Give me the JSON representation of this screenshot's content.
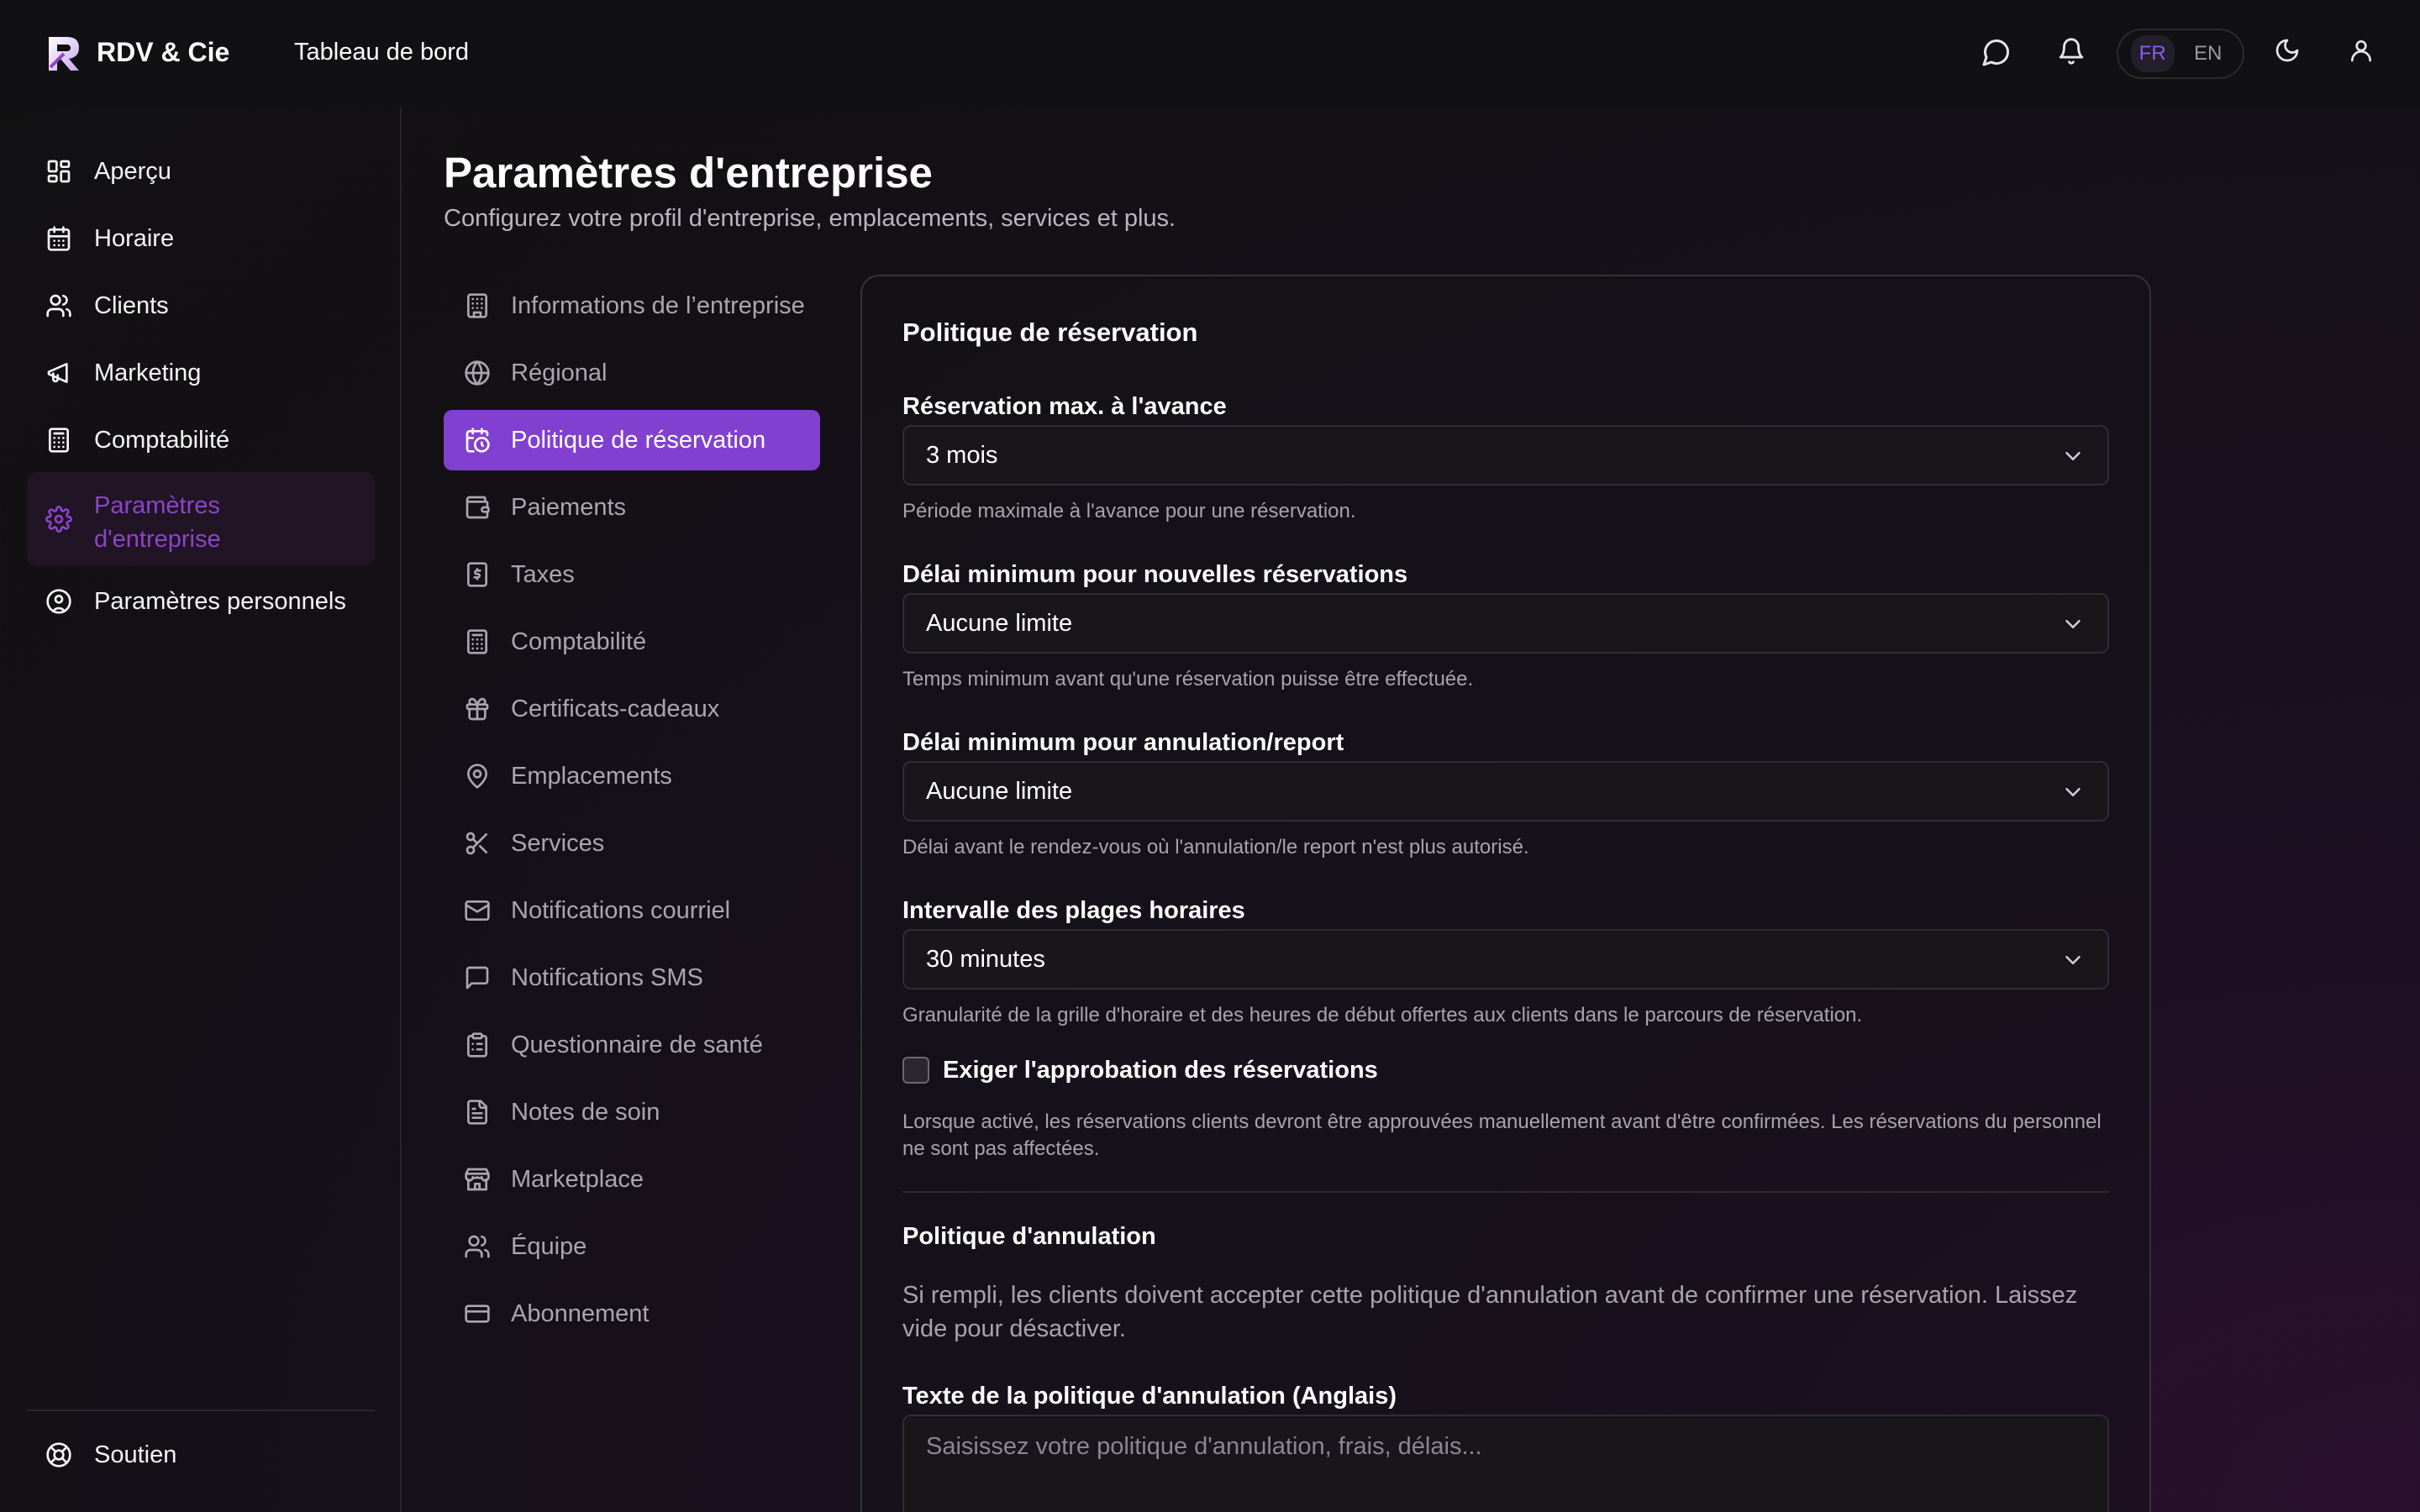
{
  "header": {
    "brand": "RDV & Cie",
    "title": "Tableau de bord",
    "lang_fr": "FR",
    "lang_en": "EN"
  },
  "colors": {
    "accent": "#8240d0",
    "accent_text": "#8b45c8",
    "lang_active": "#8b5cf6"
  },
  "sidebar": {
    "items": [
      {
        "label": "Aperçu",
        "icon": "dashboard-icon"
      },
      {
        "label": "Horaire",
        "icon": "calendar-icon"
      },
      {
        "label": "Clients",
        "icon": "users-icon"
      },
      {
        "label": "Marketing",
        "icon": "megaphone-icon"
      },
      {
        "label": "Comptabilité",
        "icon": "calculator-icon"
      },
      {
        "label_line1": "Paramètres",
        "label_line2": "d'entreprise",
        "icon": "gear-icon",
        "active": true
      },
      {
        "label": "Paramètres personnels",
        "icon": "user-circle-icon"
      }
    ],
    "support": "Soutien"
  },
  "page": {
    "title": "Paramètres d'entreprise",
    "subtitle": "Configurez votre profil d'entreprise, emplacements, services et plus."
  },
  "settings_nav": [
    {
      "label": "Informations de l’entreprise",
      "icon": "building-icon"
    },
    {
      "label": "Régional",
      "icon": "globe-icon"
    },
    {
      "label": "Politique de réservation",
      "icon": "calendar-clock-icon",
      "active": true
    },
    {
      "label": "Paiements",
      "icon": "wallet-icon"
    },
    {
      "label": "Taxes",
      "icon": "receipt-icon"
    },
    {
      "label": "Comptabilité",
      "icon": "calculator-icon"
    },
    {
      "label": "Certificats-cadeaux",
      "icon": "gift-icon"
    },
    {
      "label": "Emplacements",
      "icon": "map-pin-icon"
    },
    {
      "label": "Services",
      "icon": "scissors-icon"
    },
    {
      "label": "Notifications courriel",
      "icon": "mail-icon"
    },
    {
      "label": "Notifications SMS",
      "icon": "message-icon"
    },
    {
      "label": "Questionnaire de santé",
      "icon": "clipboard-icon"
    },
    {
      "label": "Notes de soin",
      "icon": "notes-icon"
    },
    {
      "label": "Marketplace",
      "icon": "store-icon"
    },
    {
      "label": "Équipe",
      "icon": "team-icon"
    },
    {
      "label": "Abonnement",
      "icon": "credit-card-icon"
    }
  ],
  "form": {
    "title": "Politique de réservation",
    "max_advance": {
      "label": "Réservation max. à l'avance",
      "value": "3 mois",
      "hint": "Période maximale à l'avance pour une réservation."
    },
    "min_new": {
      "label": "Délai minimum pour nouvelles réservations",
      "value": "Aucune limite",
      "hint": "Temps minimum avant qu'une réservation puisse être effectuée."
    },
    "min_cancel": {
      "label": "Délai minimum pour annulation/report",
      "value": "Aucune limite",
      "hint": "Délai avant le rendez-vous où l'annulation/le report n'est plus autorisé."
    },
    "slot_interval": {
      "label": "Intervalle des plages horaires",
      "value": "30 minutes",
      "hint": "Granularité de la grille d'horaire et des heures de début offertes aux clients dans le parcours de réservation."
    },
    "approval": {
      "label": "Exiger l'approbation des réservations",
      "checked": false,
      "hint": "Lorsque activé, les réservations clients devront être approuvées manuellement avant d'être confirmées. Les réservations du personnel ne sont pas affectées."
    },
    "cancellation": {
      "title": "Politique d'annulation",
      "description": "Si rempli, les clients doivent accepter cette politique d'annulation avant de confirmer une réservation. Laissez vide pour désactiver.",
      "text_label": "Texte de la politique d'annulation (Anglais)",
      "placeholder": "Saisissez votre politique d'annulation, frais, délais..."
    }
  }
}
